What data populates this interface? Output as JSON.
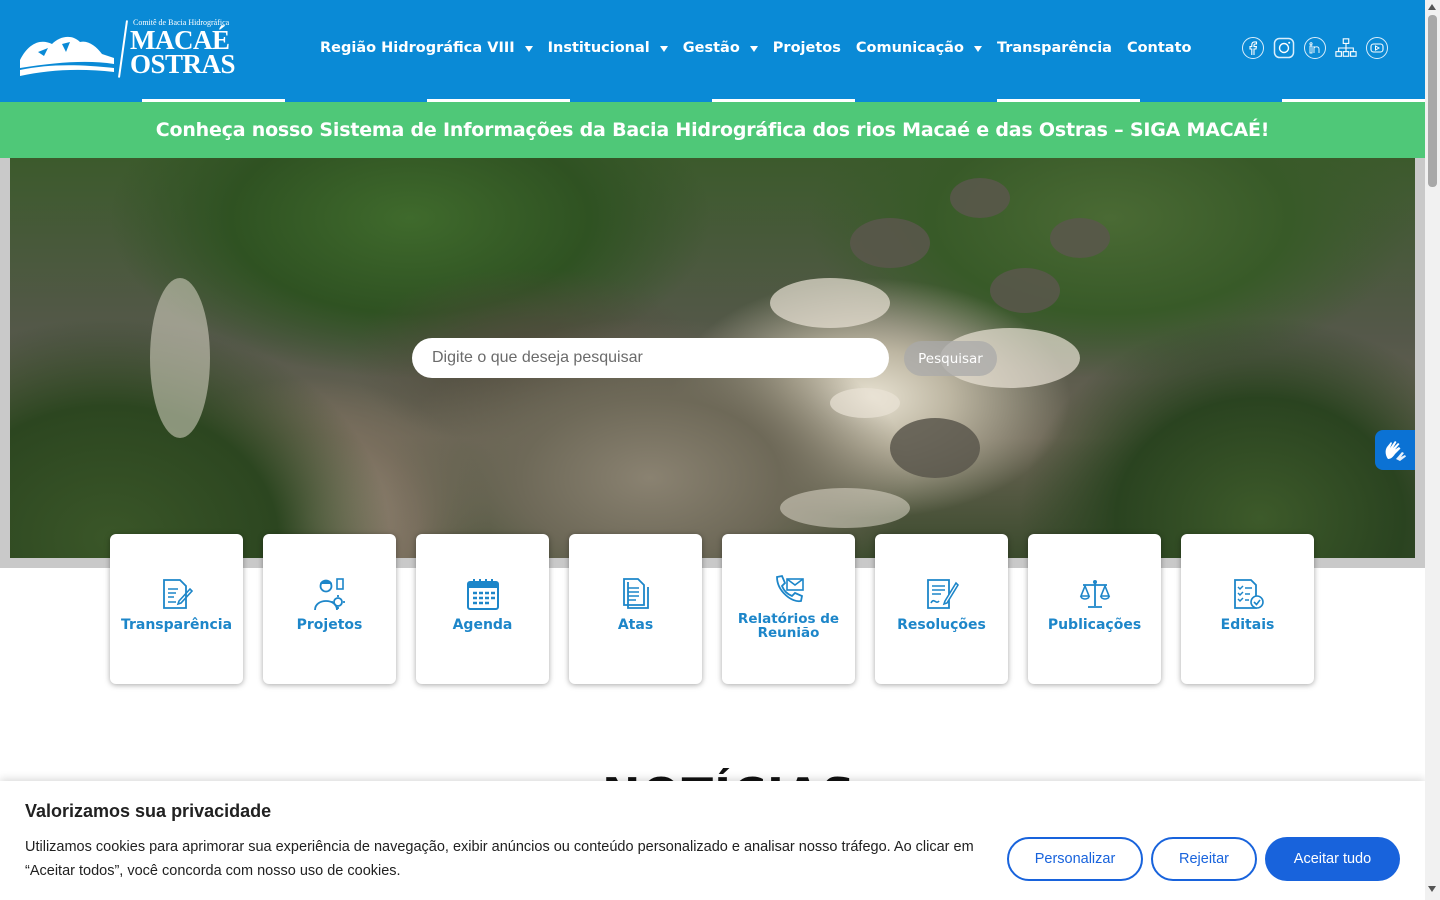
{
  "logo": {
    "small_text": "Comitê de Bacia Hidrográfica",
    "line1": "MACAÉ",
    "line2": "OSTRAS"
  },
  "nav": {
    "items": [
      {
        "label": "Região Hidrográfica VIII",
        "has_dropdown": true
      },
      {
        "label": "Institucional",
        "has_dropdown": true
      },
      {
        "label": "Gestão",
        "has_dropdown": true
      },
      {
        "label": "Projetos",
        "has_dropdown": false
      },
      {
        "label": "Comunicação",
        "has_dropdown": true
      },
      {
        "label": "Transparência",
        "has_dropdown": false
      },
      {
        "label": "Contato",
        "has_dropdown": false
      }
    ]
  },
  "social": {
    "icons": [
      "facebook-icon",
      "instagram-icon",
      "linkedin-icon",
      "sitemap-icon",
      "youtube-icon"
    ]
  },
  "banner": {
    "text": "Conheça nosso Sistema de Informações da Bacia Hidrográfica dos rios Macaé e das Ostras – SIGA MACAÉ!"
  },
  "search": {
    "placeholder": "Digite o que deseja pesquisar",
    "value": "",
    "button_label": "Pesquisar"
  },
  "quick_links": [
    {
      "label": "Transparência",
      "icon": "document-pen-icon"
    },
    {
      "label": "Projetos",
      "icon": "engineer-icon"
    },
    {
      "label": "Agenda",
      "icon": "calendar-icon"
    },
    {
      "label": "Atas",
      "icon": "documents-icon"
    },
    {
      "label": "Relatórios de Reunião",
      "icon": "phone-mail-icon"
    },
    {
      "label": "Resoluções",
      "icon": "signature-icon"
    },
    {
      "label": "Publicações",
      "icon": "scales-icon"
    },
    {
      "label": "Editais",
      "icon": "checklist-icon"
    }
  ],
  "news": {
    "title": "NOTÍCIAS"
  },
  "cookie": {
    "title": "Valorizamos sua privacidade",
    "text": "Utilizamos cookies para aprimorar sua experiência de navegação, exibir anúncios ou conteúdo personalizado e analisar nosso tráfego. Ao clicar em “Aceitar todos”, você concorda com nosso uso de cookies.",
    "customize_label": "Personalizar",
    "reject_label": "Rejeitar",
    "accept_label": "Aceitar tudo"
  },
  "colors": {
    "header_blue": "#0a8ad6",
    "banner_green": "#4fc878",
    "card_text_blue": "#1d86c9",
    "cookie_blue": "#1863dc"
  }
}
